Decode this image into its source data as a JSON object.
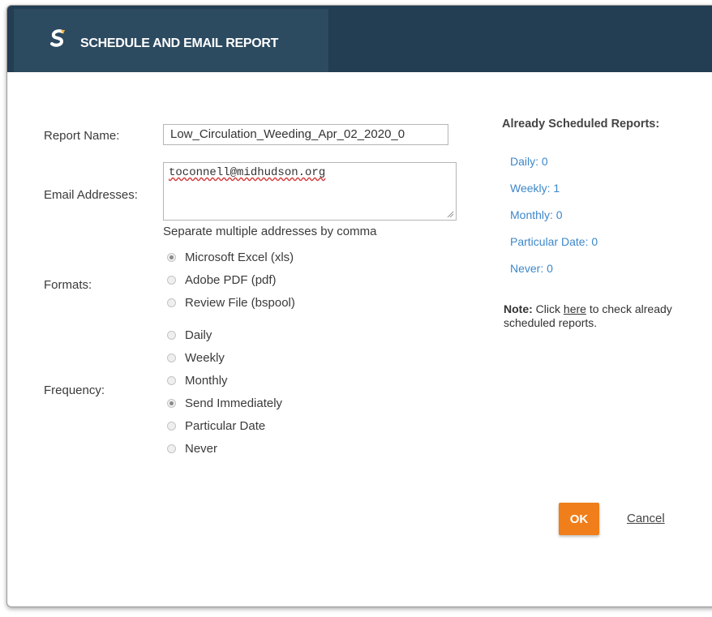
{
  "dialog": {
    "title": "SCHEDULE AND EMAIL REPORT",
    "logo_icon": "s-brand-logo-icon",
    "colors": {
      "titlebar": "#233d52",
      "accent": "#f07e1a",
      "link": "#3d87c9"
    }
  },
  "form": {
    "report_name_label": "Report Name:",
    "report_name_value": "Low_Circulation_Weeding_Apr_02_2020_0",
    "email_label": "Email Addresses:",
    "email_value": "toconnell@midhudson.org",
    "email_hint": "Separate multiple addresses by comma",
    "formats_label": "Formats:",
    "formats": [
      {
        "label": "Microsoft Excel (xls)",
        "checked": true
      },
      {
        "label": "Adobe PDF (pdf)",
        "checked": false
      },
      {
        "label": "Review File (bspool)",
        "checked": false
      }
    ],
    "frequency_label": "Frequency:",
    "frequency": [
      {
        "label": "Daily",
        "checked": false
      },
      {
        "label": "Weekly",
        "checked": false
      },
      {
        "label": "Monthly",
        "checked": false
      },
      {
        "label": "Send Immediately",
        "checked": true
      },
      {
        "label": "Particular Date",
        "checked": false
      },
      {
        "label": "Never",
        "checked": false
      }
    ]
  },
  "scheduled": {
    "heading": "Already Scheduled Reports:",
    "items": [
      "Daily: 0",
      "Weekly: 1",
      "Monthly: 0",
      "Particular Date: 0",
      "Never: 0"
    ],
    "note_bold": "Note:",
    "note_pre": " Click ",
    "note_link": "here",
    "note_post": " to check already scheduled reports."
  },
  "actions": {
    "ok_label": "OK",
    "cancel_label": "Cancel"
  }
}
